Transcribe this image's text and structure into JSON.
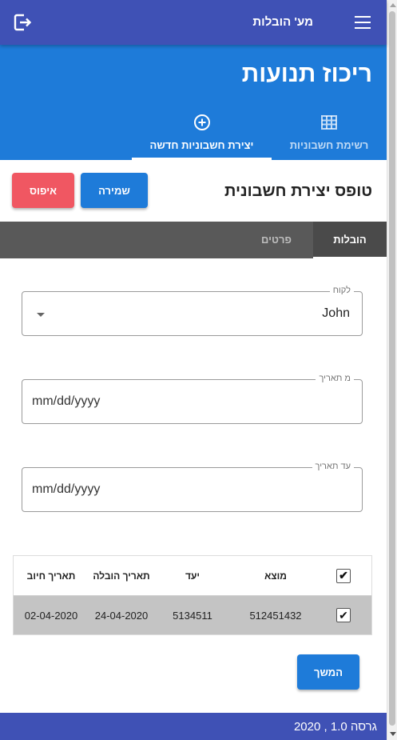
{
  "topbar": {
    "title": "מע' הובלות",
    "menu_icon": "menu-icon",
    "logout_icon": "logout-icon",
    "color": "#3f51b5"
  },
  "hero": {
    "title": "ריכוז תנועות",
    "color": "#1e7bd9"
  },
  "tabs": [
    {
      "label": "רשימת חשבוניות",
      "icon": "grid-icon",
      "active": false
    },
    {
      "label": "יצירת חשבוניות חדשה",
      "icon": "add-circle-icon",
      "active": true
    }
  ],
  "form": {
    "title": "טופס יצירת חשבונית",
    "save_label": "שמירה",
    "reset_label": "איפוס"
  },
  "subtabs": [
    {
      "label": "הובלות",
      "active": true
    },
    {
      "label": "פרטים",
      "active": false
    }
  ],
  "fields": {
    "customer": {
      "label": "לקוח",
      "value": "John"
    },
    "from_date": {
      "label": "מ תאריך",
      "placeholder": "mm/dd/yyyy"
    },
    "to_date": {
      "label": "עד תאריך",
      "placeholder": "mm/dd/yyyy"
    }
  },
  "table": {
    "header_checked": true,
    "columns": {
      "origin": "מוצא",
      "destination": "יעד",
      "delivery_date": "תאריך הובלה",
      "charge_date": "תאריך חיוב"
    },
    "rows": [
      {
        "checked": true,
        "origin": "512451432",
        "destination": "5134511",
        "delivery_date": "24-04-2020",
        "charge_date": "02-04-2020"
      }
    ]
  },
  "continue_label": "המשך",
  "footer": {
    "version": "גרסה 1.0 , 2020"
  },
  "colors": {
    "primary": "#3f51b5",
    "accent": "#1e7bd9",
    "danger": "#f05762",
    "subtab_bar": "#595959"
  }
}
